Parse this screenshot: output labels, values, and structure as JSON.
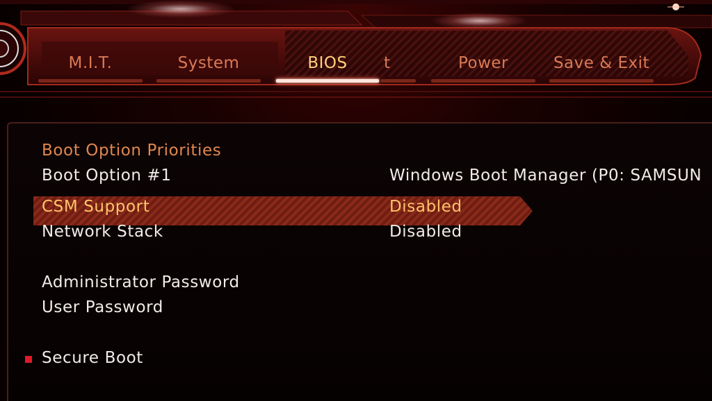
{
  "tabs": [
    {
      "label": "M.I.T.",
      "active": false
    },
    {
      "label": "System",
      "active": false
    },
    {
      "label": "BIOS",
      "active": true
    },
    {
      "label": "t",
      "active": false
    },
    {
      "label": "Power",
      "active": false
    },
    {
      "label": "Save & Exit",
      "active": false
    }
  ],
  "settings": {
    "section_title": "Boot Option Priorities",
    "boot_option_1": {
      "label": "Boot Option #1",
      "value": "Windows Boot Manager (P0: SAMSUN"
    },
    "csm_support": {
      "label": "CSM Support",
      "value": "Disabled",
      "selected": true
    },
    "network_stack": {
      "label": "Network Stack",
      "value": "Disabled"
    },
    "admin_password": {
      "label": "Administrator Password"
    },
    "user_password": {
      "label": "User Password"
    },
    "secure_boot": {
      "label": "Secure Boot",
      "submenu": true
    }
  },
  "colors": {
    "accent": "#d97a55",
    "active_tab": "#ffd07a",
    "selected_text": "#ffc46a",
    "highlight": "#7a2416",
    "submenu_marker": "#e01a2a",
    "background": "#080000"
  },
  "icons": {
    "logo": "gear-logo-icon",
    "submenu_marker": "red-square-icon"
  }
}
